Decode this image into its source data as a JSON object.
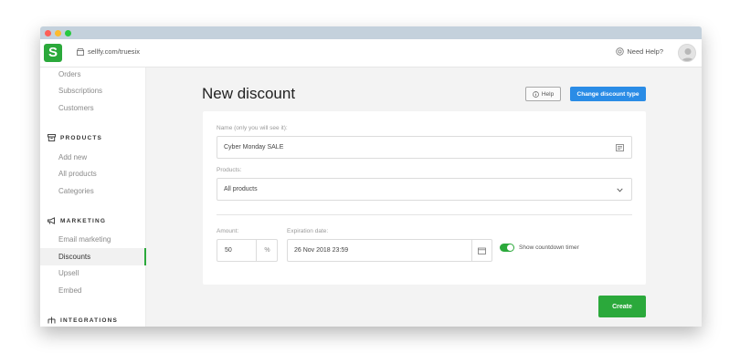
{
  "window": {
    "dots": {
      "close": "#fd5f57",
      "minimize": "#fdbb2e",
      "maximize": "#28c840"
    }
  },
  "topbar": {
    "logo_letter": "S",
    "store_url": "sellfy.com/truesix",
    "help_label": "Need Help?",
    "brand_color": "#2ba93b"
  },
  "sidebar": {
    "items_top": [
      "Orders",
      "Subscriptions",
      "Customers"
    ],
    "products_heading": "PRODUCTS",
    "products_items": [
      "Add new",
      "All products",
      "Categories"
    ],
    "marketing_heading": "MARKETING",
    "marketing_items": [
      "Email marketing",
      "Discounts",
      "Upsell",
      "Embed"
    ],
    "integrations_heading": "INTEGRATIONS",
    "active_item": "Discounts"
  },
  "main": {
    "title": "New discount",
    "help_button": "Help",
    "change_type_button": "Change discount type",
    "name_label": "Name (only you will see it):",
    "name_value": "Cyber Monday SALE",
    "products_label": "Products:",
    "products_value": "All products",
    "amount_label": "Amount:",
    "amount_value": "50",
    "amount_unit": "%",
    "expiration_label": "Expiration date:",
    "expiration_value": "26 Nov 2018 23:59",
    "countdown_label": "Show countdown timer",
    "countdown_enabled": true,
    "create_button": "Create"
  }
}
